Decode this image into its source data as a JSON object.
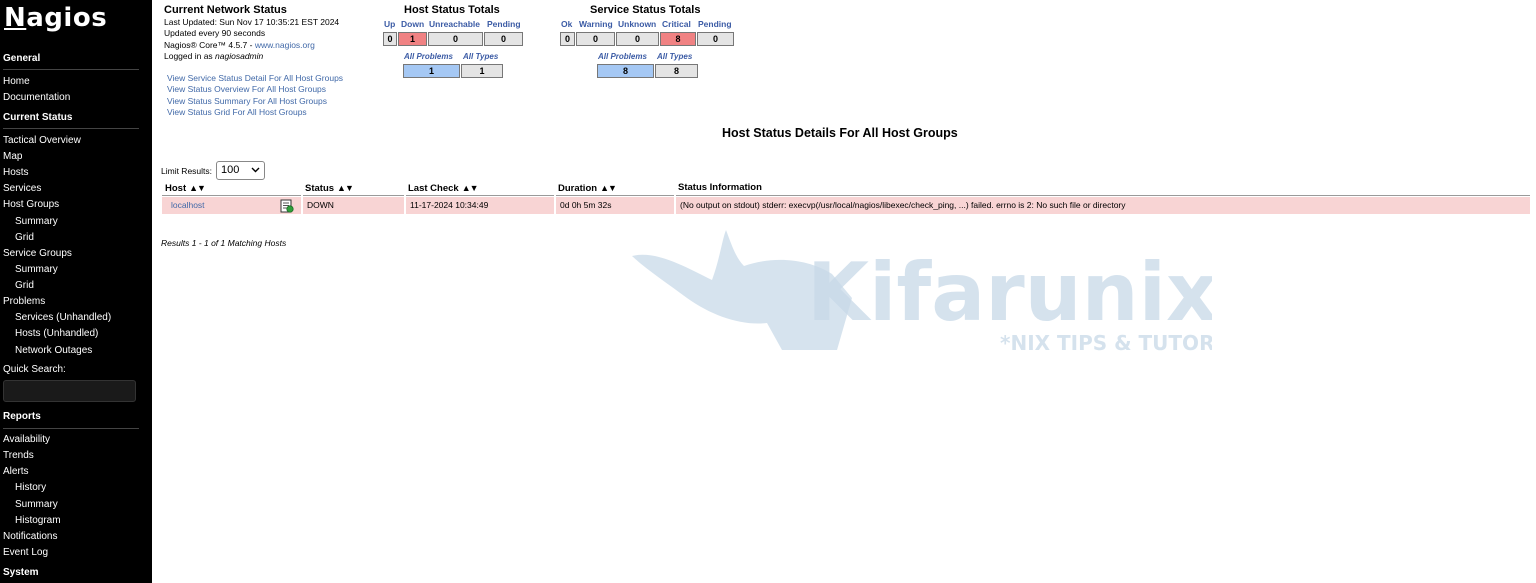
{
  "sidebar": {
    "logo": "Nagios",
    "general_heading": "General",
    "general_items": [
      "Home",
      "Documentation"
    ],
    "current_status_heading": "Current Status",
    "current_items": [
      "Tactical Overview",
      "Map",
      "Hosts",
      "Services",
      "Host Groups",
      "Summary",
      "Grid",
      "Service Groups",
      "Summary",
      "Grid",
      "Problems",
      "Services (Unhandled)",
      "Hosts (Unhandled)",
      "Network Outages"
    ],
    "quick_search_label": "Quick Search:",
    "quick_search_value": "",
    "reports_heading": "Reports",
    "reports_items": [
      "Availability",
      "Trends",
      "Alerts",
      "History",
      "Summary",
      "Histogram",
      "Notifications",
      "Event Log"
    ],
    "system_heading": "System"
  },
  "network_status": {
    "title": "Current Network Status",
    "last_updated": "Last Updated: Sun Nov 17 10:35:21 EST 2024",
    "update_interval": "Updated every 90 seconds",
    "version_prefix": "Nagios® Core™ 4.5.7 - ",
    "version_link": "www.nagios.org",
    "logged_in_prefix": "Logged in as ",
    "logged_in_user": "nagiosadmin",
    "links": [
      "View Service Status Detail For All Host Groups",
      "View Status Overview For All Host Groups",
      "View Status Summary For All Host Groups",
      "View Status Grid For All Host Groups"
    ]
  },
  "host_totals": {
    "title": "Host Status Totals",
    "headers": [
      "Up",
      "Down",
      "Unreachable",
      "Pending"
    ],
    "values": [
      "0",
      "1",
      "0",
      "0"
    ],
    "sub_headers": [
      "All Problems",
      "All Types"
    ],
    "sub_values": [
      "1",
      "1"
    ]
  },
  "service_totals": {
    "title": "Service Status Totals",
    "headers": [
      "Ok",
      "Warning",
      "Unknown",
      "Critical",
      "Pending"
    ],
    "values": [
      "0",
      "0",
      "0",
      "8",
      "0"
    ],
    "sub_headers": [
      "All Problems",
      "All Types"
    ],
    "sub_values": [
      "8",
      "8"
    ]
  },
  "page_title": "Host Status Details For All Host Groups",
  "limit": {
    "label": "Limit Results:",
    "selected": "100"
  },
  "table": {
    "columns": [
      "Host",
      "Status",
      "Last Check",
      "Duration",
      "Status Information"
    ],
    "rows": [
      {
        "host": "localhost",
        "status": "DOWN",
        "last_check": "11-17-2024 10:34:49",
        "duration": "0d 0h 5m 32s",
        "info": "(No output on stdout) stderr: execvp(/usr/local/nagios/libexec/check_ping, ...) failed. errno is 2: No such file or directory"
      }
    ]
  },
  "results_text": "Results 1 - 1 of 1 Matching Hosts",
  "watermark": {
    "brand": "Kifarunix",
    "tagline": "*NIX TIPS & TUTORIALS"
  },
  "colors": {
    "sidebar_bg": "#000000",
    "link": "#4169a8",
    "critical": "#f08283",
    "problem_row": "#f8d4d4",
    "blue_box": "#a5c8f4"
  }
}
